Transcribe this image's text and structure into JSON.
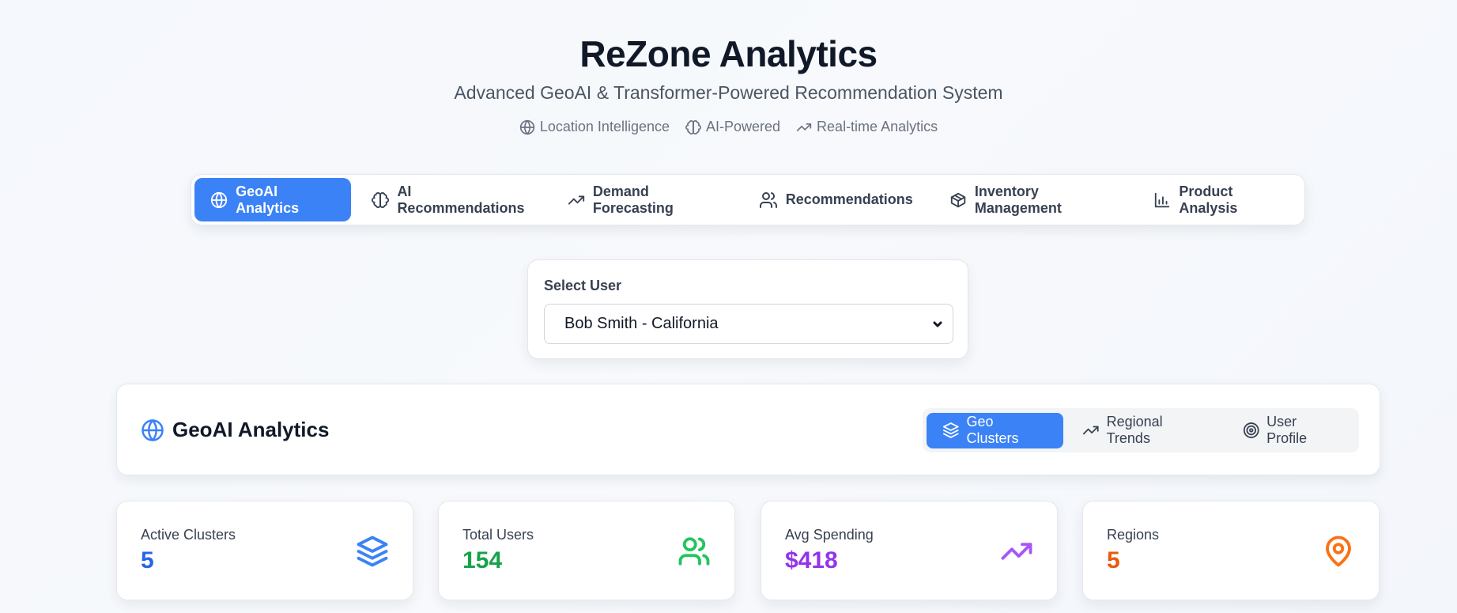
{
  "header": {
    "title": "ReZone Analytics",
    "subtitle": "Advanced GeoAI & Transformer-Powered Recommendation System",
    "features": [
      {
        "label": "Location Intelligence",
        "icon": "globe-icon"
      },
      {
        "label": "AI-Powered",
        "icon": "brain-icon"
      },
      {
        "label": "Real-time Analytics",
        "icon": "trending-up-icon"
      }
    ]
  },
  "main_nav": {
    "tabs": [
      {
        "label": "GeoAI Analytics",
        "icon": "globe-icon",
        "active": true
      },
      {
        "label": "AI Recommendations",
        "icon": "brain-icon"
      },
      {
        "label": "Demand Forecasting",
        "icon": "trending-up-icon"
      },
      {
        "label": "Recommendations",
        "icon": "users-icon"
      },
      {
        "label": "Inventory Management",
        "icon": "package-icon"
      },
      {
        "label": "Product Analysis",
        "icon": "bar-chart-icon"
      }
    ]
  },
  "user_select": {
    "label": "Select User",
    "selected": "Bob Smith - California"
  },
  "section": {
    "title": "GeoAI Analytics",
    "subtabs": [
      {
        "label": "Geo Clusters",
        "icon": "layers-icon",
        "active": true
      },
      {
        "label": "Regional Trends",
        "icon": "trending-up-icon"
      },
      {
        "label": "User Profile",
        "icon": "target-icon"
      }
    ]
  },
  "stats": [
    {
      "label": "Active Clusters",
      "value": "5",
      "color": "#2563eb",
      "icon": "layers-icon"
    },
    {
      "label": "Total Users",
      "value": "154",
      "color": "#16a34a",
      "icon": "users-icon"
    },
    {
      "label": "Avg Spending",
      "value": "$418",
      "color": "#9333ea",
      "icon": "trending-up-icon"
    },
    {
      "label": "Regions",
      "value": "5",
      "color": "#ea580c",
      "icon": "map-pin-icon"
    }
  ],
  "colors": {
    "accent": "#3b82f6"
  }
}
